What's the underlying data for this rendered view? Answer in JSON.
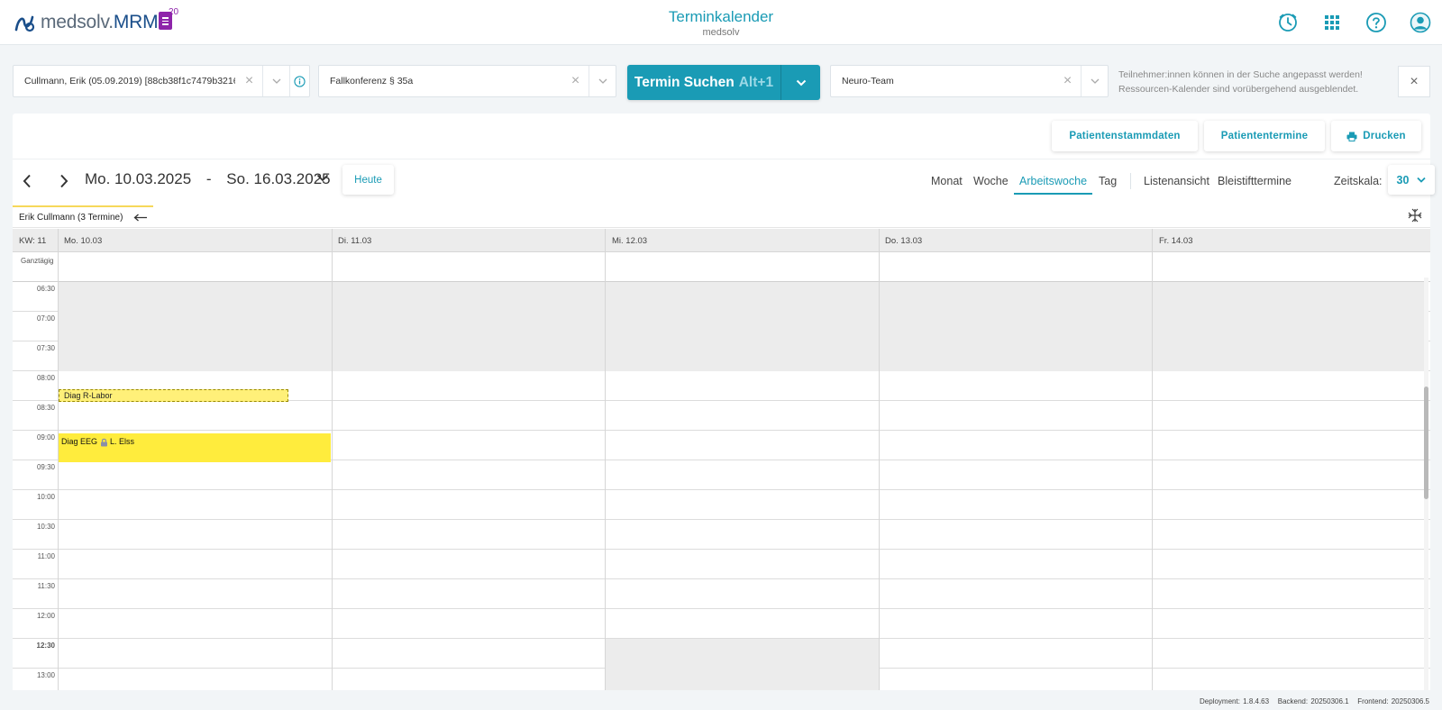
{
  "app": {
    "brand_first": "medsolv.",
    "brand_second": "MRM",
    "doc_badge_count": "20",
    "title": "Terminkalender",
    "subtitle": "medsolv"
  },
  "search": {
    "patient": "Cullmann, Erik (05.09.2019) [88cb38f1c7479b3216d...",
    "appointment_type": "Fallkonferenz § 35a",
    "search_label": "Termin Suchen",
    "search_hotkey": "Alt+1",
    "team": "Neuro-Team",
    "hint_line1": "Teilnehmer:innen können in der Suche angepasst werden!",
    "hint_line2": "Ressourcen-Kalender sind vorübergehend ausgeblendet."
  },
  "actions": {
    "master_data": "Patientenstammdaten",
    "appointments": "Patiententermine",
    "print": "Drucken"
  },
  "nav": {
    "date_from": "Mo. 10.03.2025",
    "date_sep": "-",
    "date_to": "So. 16.03.2025",
    "today": "Heute"
  },
  "views": {
    "month": "Monat",
    "week": "Woche",
    "workweek": "Arbeitswoche",
    "day": "Tag",
    "list": "Listenansicht",
    "pencil": "Bleistifttermine",
    "scale_label": "Zeitskala:",
    "scale_value": "30",
    "active": "Arbeitswoche"
  },
  "calendar": {
    "tab_label": "Erik Cullmann (3 Termine)",
    "week_label": "KW: 11",
    "days": [
      "Mo. 10.03",
      "Di. 11.03",
      "Mi. 12.03",
      "Do. 13.03",
      "Fr. 14.03"
    ],
    "allday_label": "Ganztägig",
    "times": [
      "06:30",
      "07:00",
      "07:30",
      "08:00",
      "08:30",
      "09:00",
      "09:30",
      "10:00",
      "10:30",
      "11:00",
      "11:30",
      "12:00",
      "12:30",
      "13:00"
    ],
    "events": [
      {
        "day": "Mo. 10.03",
        "title": "Diag R-Labor",
        "style": "dashed"
      },
      {
        "day": "Mo. 10.03",
        "title": "Diag EEG",
        "person": "L. Elss",
        "style": "solid"
      }
    ],
    "colors": {
      "event": "#ffec3d",
      "accent": "#1a9bb5",
      "off_hours": "#ececec"
    }
  },
  "footer": {
    "deployment": "Deployment: 1.8.4.63",
    "backend": "Backend: 20250306.1",
    "frontend": "Frontend: 20250306.5"
  },
  "icons": [
    "logo-icon",
    "document-icon",
    "clock-icon",
    "apps-grid-icon",
    "help-icon",
    "user-icon",
    "clear-icon",
    "chevron-down-icon",
    "info-icon",
    "close-icon",
    "printer-icon",
    "chevron-left-icon",
    "chevron-right-icon",
    "arrow-left-icon",
    "expand-icon",
    "lock-icon"
  ]
}
